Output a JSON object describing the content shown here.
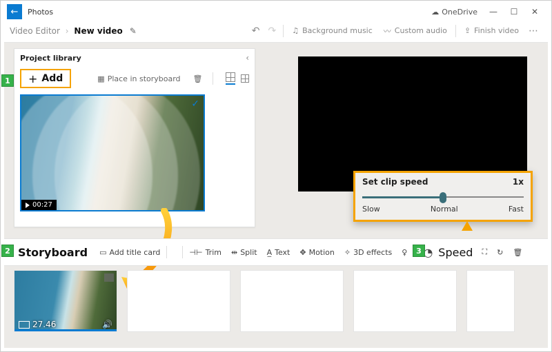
{
  "titlebar": {
    "app_title": "Photos",
    "onedrive_label": "OneDrive",
    "min": "—",
    "max": "☐",
    "close": "✕",
    "back": "←"
  },
  "header": {
    "crumb_root": "Video Editor",
    "crumb_current": "New video",
    "undo": "↶",
    "redo": "↷",
    "bg_music": "Background music",
    "custom_audio": "Custom audio",
    "finish": "Finish video"
  },
  "library": {
    "title": "Project library",
    "add_label": "Add",
    "place_label": "Place in storyboard",
    "clip_duration": "00:27"
  },
  "speed_popover": {
    "title": "Set clip speed",
    "value": "1x",
    "slow": "Slow",
    "normal": "Normal",
    "fast": "Fast"
  },
  "storyboard": {
    "title": "Storyboard",
    "add_title_card": "Add title card",
    "trim": "Trim",
    "split": "Split",
    "text": "Text",
    "motion": "Motion",
    "effects": "3D effects",
    "speed": "Speed",
    "clip_duration": "27.46"
  },
  "callouts": {
    "one": "1",
    "two": "2",
    "three": "3"
  }
}
